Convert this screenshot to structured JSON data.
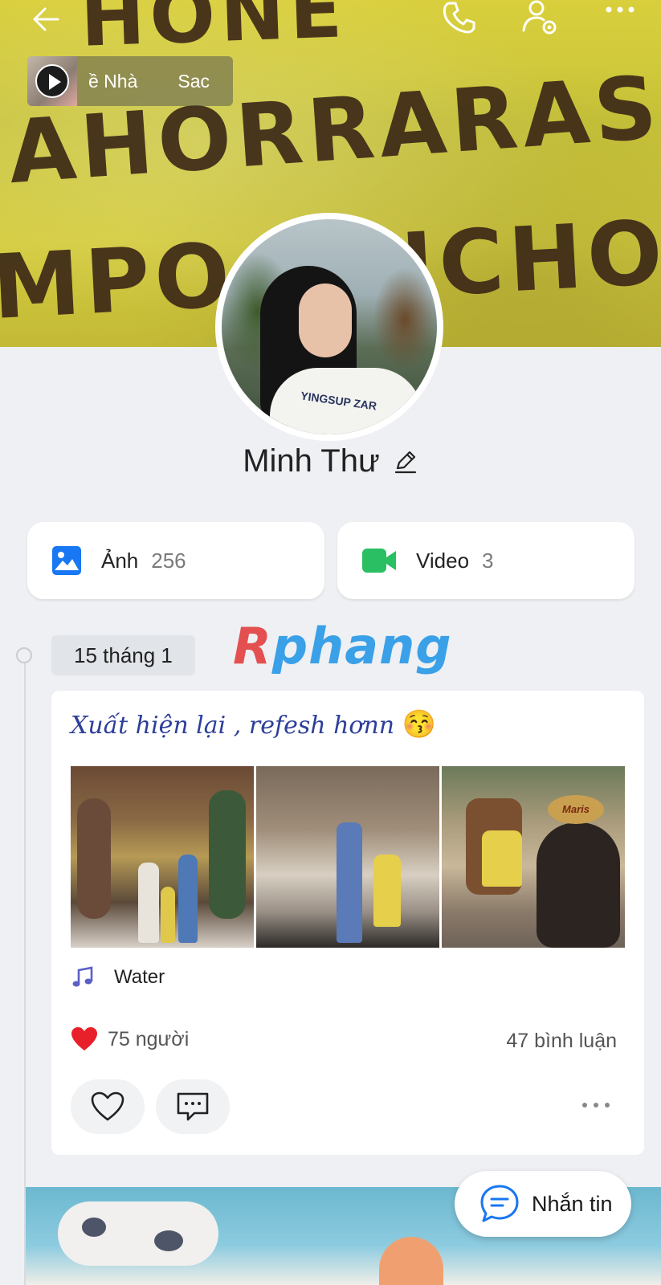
{
  "cover": {
    "graffiti_lines": [
      "HONE",
      "AHORRARAS",
      "MPO MUCHO"
    ]
  },
  "music_chip": {
    "song_title": "ề Nhà",
    "artist": "Sac"
  },
  "profile": {
    "name": "Minh Thư",
    "shirt_text": "YINGSUP ZAR"
  },
  "media": {
    "photos_label": "Ảnh",
    "photos_count": "256",
    "videos_label": "Video",
    "videos_count": "3"
  },
  "timeline": {
    "date": "15 tháng 1"
  },
  "watermark": {
    "text_r": "R",
    "text_rest": "phang"
  },
  "post": {
    "text": "Xuất hiện lại , refesh hơnn",
    "emoji": "😚",
    "music": "Water",
    "likes": "75 người",
    "comments": "47 bình luận",
    "photo_badge": "Maris"
  },
  "fab": {
    "label": "Nhắn tin"
  },
  "colors": {
    "accent_blue": "#1877f2",
    "video_green": "#2bbf63",
    "heart_red": "#e8202a",
    "post_text_blue": "#2d3e9a"
  }
}
